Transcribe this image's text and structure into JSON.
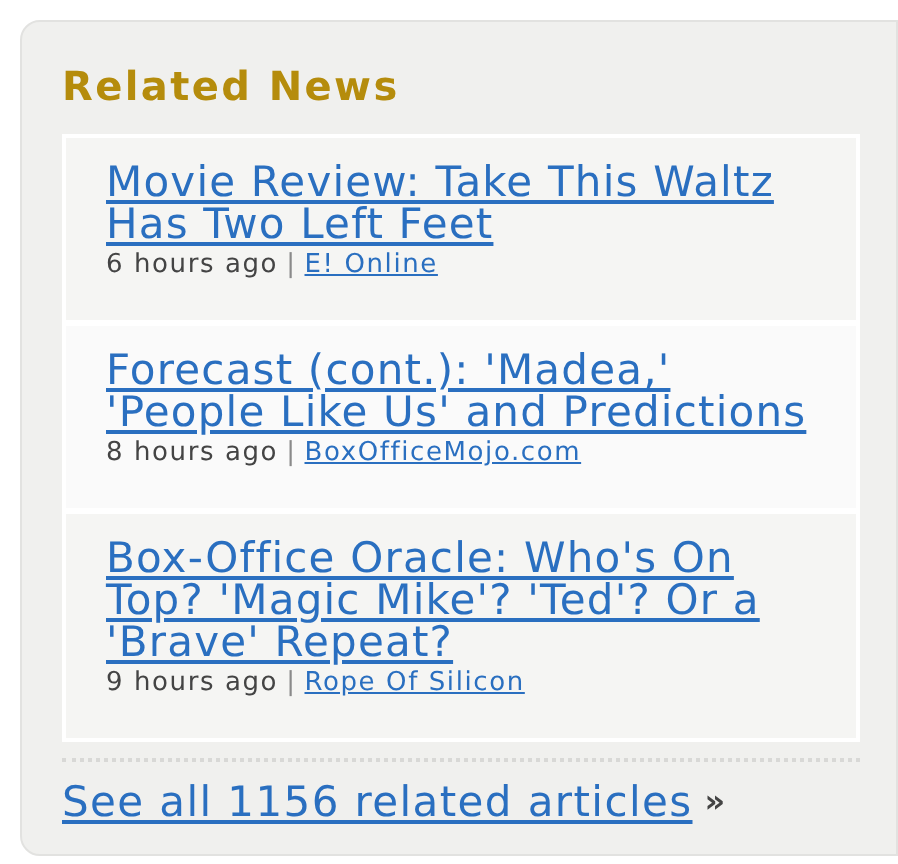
{
  "panel": {
    "title": "Related News"
  },
  "articles": [
    {
      "headline": "Movie Review: Take This Waltz Has Two Left Feet",
      "time": "6 hours ago",
      "separator": "|",
      "source": "E! Online"
    },
    {
      "headline": "Forecast (cont.): 'Madea,' 'People Like Us' and Predictions",
      "time": "8 hours ago",
      "separator": "|",
      "source": "BoxOfficeMojo.com"
    },
    {
      "headline": "Box-Office Oracle: Who's On Top? 'Magic Mike'? 'Ted'? Or a 'Brave' Repeat?",
      "time": "9 hours ago",
      "separator": "|",
      "source": "Rope Of Silicon"
    }
  ],
  "footer": {
    "link": "See all 1156 related articles",
    "arrow": "»"
  }
}
